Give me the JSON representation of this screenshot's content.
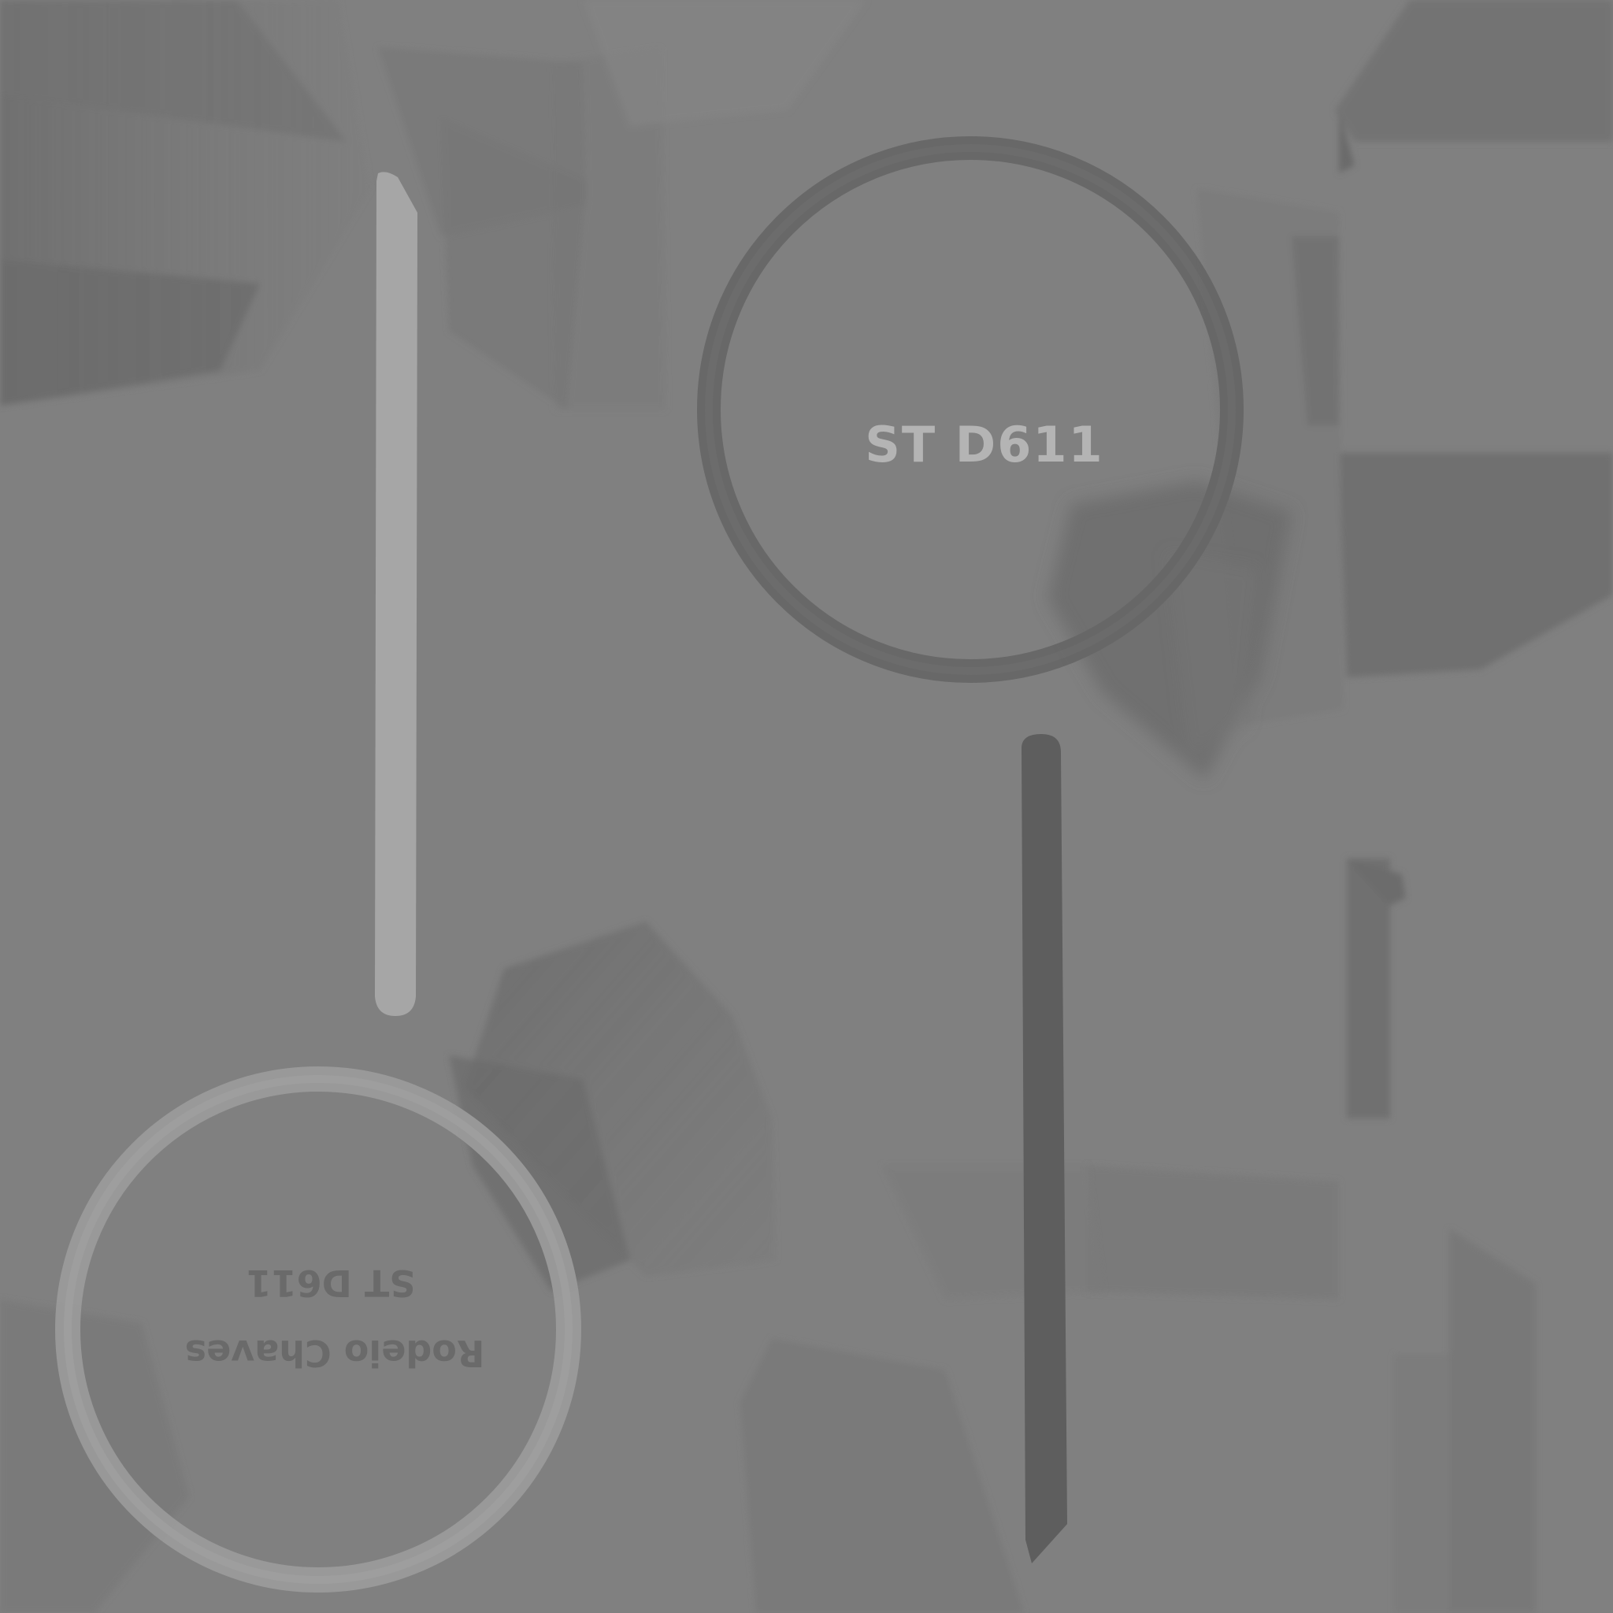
{
  "texture": {
    "background_color": "#808080",
    "upper_stamp": {
      "code": "ST D611",
      "ring_color": "#666666",
      "text_color": "#b4b4b4"
    },
    "lower_stamp": {
      "code": "ST D611",
      "name": "Rodeio Chaves",
      "ring_color": "#9a9a9a",
      "text_color": "#6a6a6a"
    },
    "light_stripe_color": "#a6a6a6",
    "dark_stripe_color": "#5e5e5e"
  }
}
